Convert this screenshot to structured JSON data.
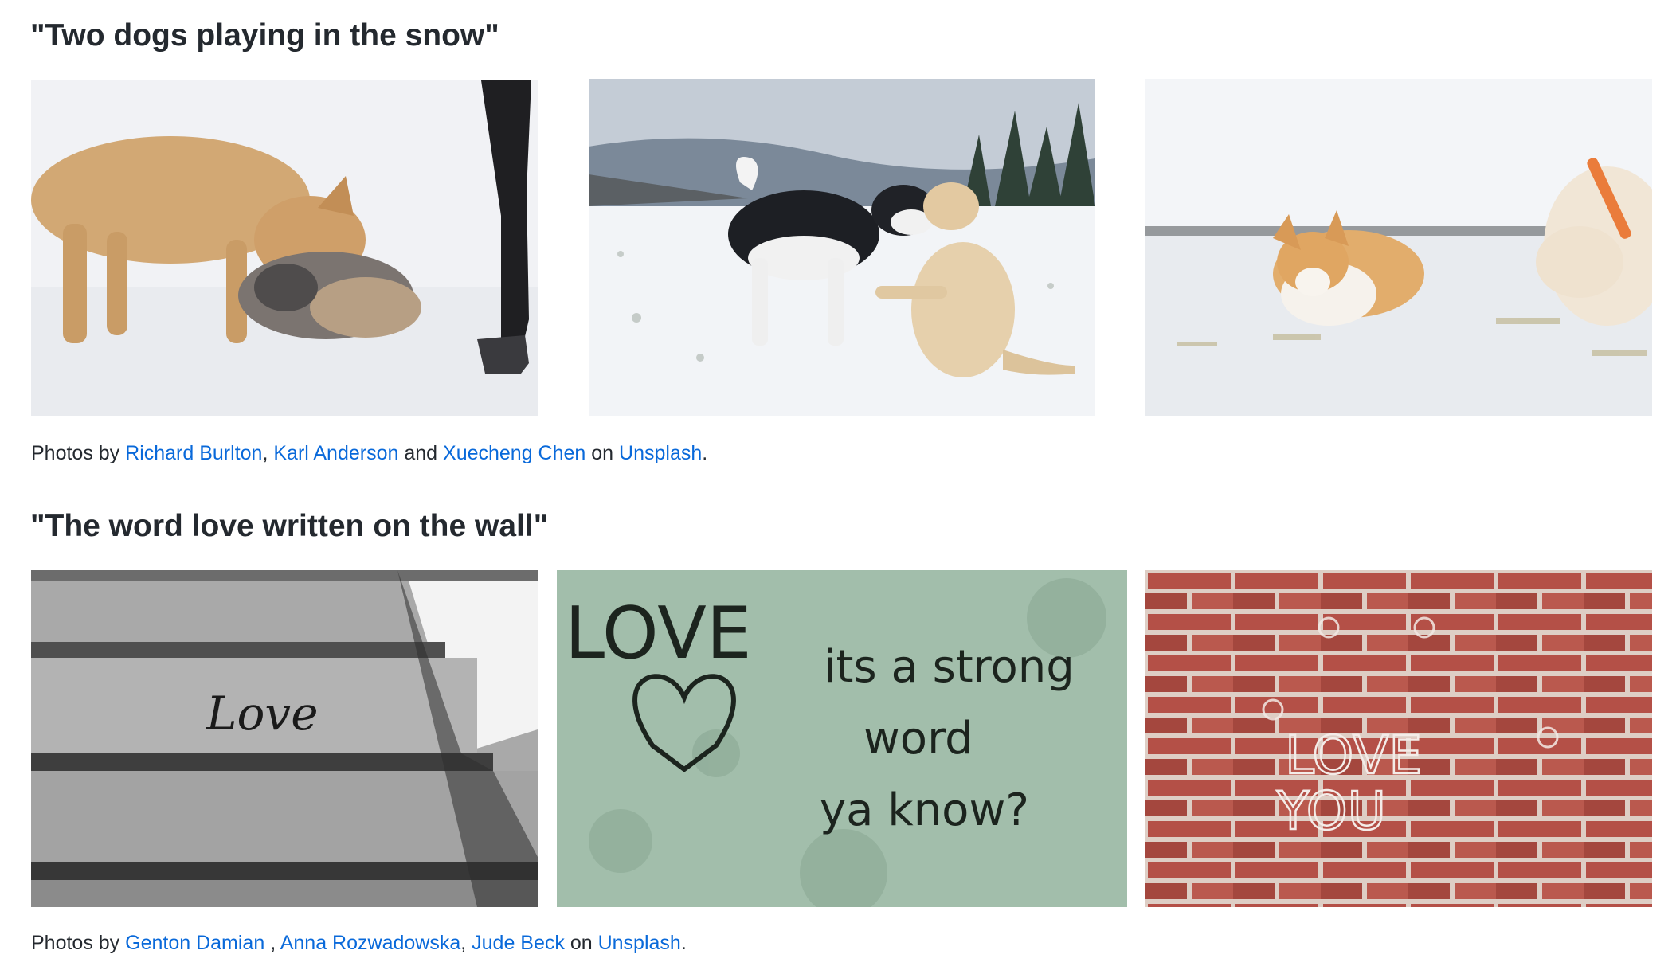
{
  "section1": {
    "heading": "\"Two dogs playing in the snow\"",
    "credit": {
      "prefix": "Photos by ",
      "author1": "Richard Burlton",
      "sep1": ", ",
      "author2": "Karl Anderson",
      "sep2": " and ",
      "author3": "Xuecheng Chen",
      "on": " on ",
      "source": "Unsplash",
      "end": "."
    }
  },
  "section2": {
    "heading": "\"The word love written on the wall\"",
    "credit": {
      "prefix": "Photos by ",
      "author1": "Genton Damian",
      "sep1": " , ",
      "author2": "Anna Rozwadowska",
      "sep2": ", ",
      "author3": "Jude Beck",
      "on": " on ",
      "source": "Unsplash",
      "end": "."
    }
  },
  "graffiti": {
    "love_stairs": "Love",
    "love_green": "LOVE",
    "green_line1": "its a strong",
    "green_line2": "word",
    "green_line3": "ya know?",
    "brick_line1": "LOVE",
    "brick_line2": "YOU"
  },
  "colors": {
    "link": "#0969da",
    "text": "#24292f"
  }
}
